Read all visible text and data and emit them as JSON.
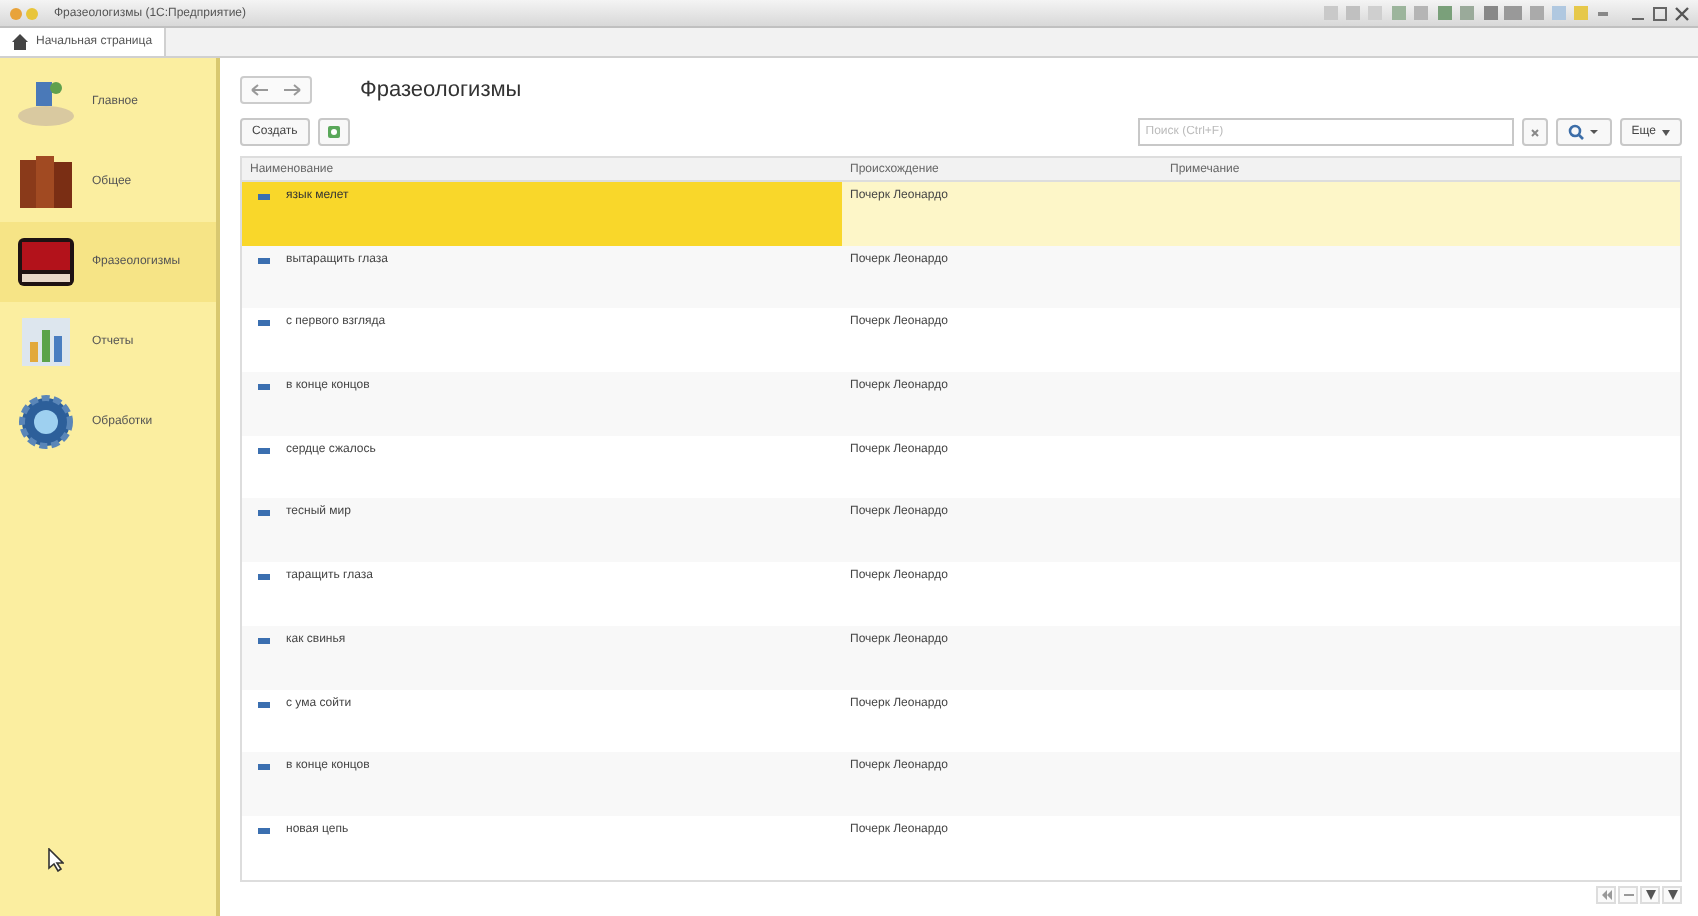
{
  "window": {
    "title": "Фразеологизмы (1С:Предприятие)"
  },
  "tabs": [
    {
      "label": "Начальная страница",
      "selected": true
    }
  ],
  "sidebar": {
    "items": [
      {
        "label": "Главное",
        "selected": false
      },
      {
        "label": "Общее",
        "selected": false
      },
      {
        "label": "Фразеологизмы",
        "selected": true
      },
      {
        "label": "Отчеты",
        "selected": false
      },
      {
        "label": "Обработки",
        "selected": false
      }
    ]
  },
  "form": {
    "title": "Фразеологизмы",
    "create_button": "Создать",
    "search": {
      "placeholder": "Поиск (Ctrl+F)"
    },
    "more_button": "Еще"
  },
  "table": {
    "columns": [
      "Наименование",
      "Происхождение",
      "Примечание"
    ],
    "rows": [
      {
        "name": "язык мелет",
        "origin": "Почерк Леонардо",
        "selected": true
      },
      {
        "name": "вытаращить глаза",
        "origin": "Почерк Леонардо",
        "selected": false
      },
      {
        "name": "с первого взгляда",
        "origin": "Почерк Леонардо",
        "selected": false
      },
      {
        "name": "в конце концов",
        "origin": "Почерк Леонардо",
        "selected": false
      },
      {
        "name": "сердце сжалось",
        "origin": "Почерк Леонардо",
        "selected": false
      },
      {
        "name": "тесный мир",
        "origin": "Почерк Леонардо",
        "selected": false
      },
      {
        "name": "таращить глаза",
        "origin": "Почерк Леонардо",
        "selected": false
      },
      {
        "name": "как свинья",
        "origin": "Почерк Леонардо",
        "selected": false
      },
      {
        "name": "с ума сойти",
        "origin": "Почерк Леонардо",
        "selected": false
      },
      {
        "name": "в конце концов",
        "origin": "Почерк Леонардо",
        "selected": false
      },
      {
        "name": "новая цепь",
        "origin": "Почерк Леонардо",
        "selected": false
      }
    ]
  }
}
